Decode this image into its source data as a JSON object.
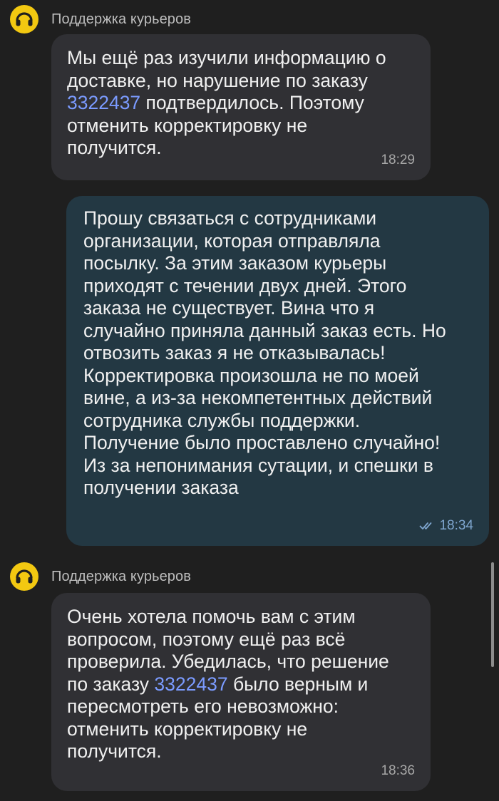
{
  "messages": [
    {
      "sender": "Поддержка курьеров",
      "lines": [
        "Мы ещё раз изучили информацию о",
        "доставке, но нарушение по заказу",
        {
          "link": "3322437",
          "rest": " подтвердилось. Поэтому"
        },
        "отменить корректировку не",
        "получится."
      ],
      "time": "18:29"
    },
    {
      "lines": [
        "Прошу связаться с сотрудниками",
        "организации, которая отправляла",
        "посылку. За этим заказом курьеры",
        "приходят с течении двух дней. Этого",
        "заказа не существует. Вина что я",
        "случайно приняла данный заказ есть. Но",
        "отвозить заказ я не отказывалась!",
        "Корректировка произошла не по моей",
        "вине, а из-за некомпетентных действий",
        "сотрудника службы поддержки.",
        "Получение было проставлено случайно!",
        "Из за непонимания сутации, и спешки в",
        "получении заказа"
      ],
      "time": "18:34",
      "status_icon": "double-check-icon"
    },
    {
      "sender": "Поддержка курьеров",
      "lines": [
        "Очень хотела помочь вам с этим",
        "вопросом, поэтому ещё раз всё",
        "проверила. Убедилась, что решение",
        {
          "prefix": "по заказу ",
          "link": "3322437",
          "rest": " было верным и"
        },
        "пересмотреть его невозможно:",
        "отменить корректировку не",
        "получится."
      ],
      "time": "18:36"
    }
  ],
  "colors": {
    "background": "#1f1f1f",
    "incoming_bubble": "#303034",
    "outgoing_bubble": "#233843",
    "link": "#7b9bff",
    "avatar": "#f2c811"
  }
}
